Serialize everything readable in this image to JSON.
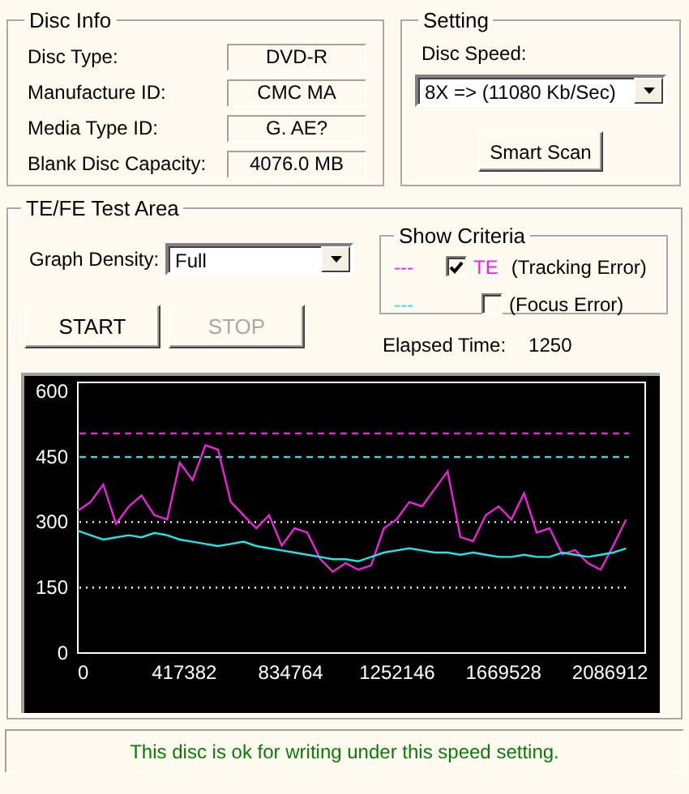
{
  "disc_info": {
    "title": "Disc Info",
    "fields": [
      {
        "label": "Disc Type:",
        "value": "DVD-R"
      },
      {
        "label": "Manufacture ID:",
        "value": "CMC MA"
      },
      {
        "label": "Media Type ID:",
        "value": "G. AE?"
      },
      {
        "label": "Blank Disc Capacity:",
        "value": "4076.0 MB"
      }
    ]
  },
  "setting": {
    "title": "Setting",
    "speed_label": "Disc Speed:",
    "speed_value": "8X => (11080 Kb/Sec)",
    "scan_button": "Smart Scan"
  },
  "test_area": {
    "title": "TE/FE Test Area",
    "density_label": "Graph Density:",
    "density_value": "Full",
    "buttons": [
      {
        "label": "START",
        "disabled": false
      },
      {
        "label": "STOP",
        "disabled": true
      }
    ],
    "criteria": {
      "title": "Show Criteria",
      "items": [
        {
          "marker": "---",
          "color": "#ee22dd",
          "checked": true,
          "name": "TE",
          "description": "(Tracking Error)"
        },
        {
          "marker": "---",
          "color": "#22e5e5",
          "checked": false,
          "description": "(Focus Error)"
        }
      ]
    },
    "elapsed_label": "Elapsed Time:",
    "elapsed_value": "1250",
    "chart_data": {
      "type": "line",
      "xlim": [
        0,
        2225000
      ],
      "ylim": [
        0,
        620
      ],
      "xticks": [
        0,
        417382,
        834764,
        1252146,
        1669528,
        2086912
      ],
      "yticks": [
        0,
        150,
        300,
        450,
        600
      ],
      "x": [
        0,
        50000,
        100000,
        150000,
        200000,
        250000,
        300000,
        350000,
        400000,
        450000,
        500000,
        550000,
        600000,
        650000,
        700000,
        750000,
        800000,
        850000,
        900000,
        950000,
        1000000,
        1050000,
        1100000,
        1150000,
        1200000,
        1250000,
        1300000,
        1350000,
        1400000,
        1450000,
        1500000,
        1550000,
        1600000,
        1650000,
        1700000,
        1750000,
        1800000,
        1850000,
        1900000,
        1950000,
        2000000,
        2050000,
        2100000,
        2150000
      ],
      "series": [
        {
          "color": "#ee22dd",
          "values": [
            326,
            346,
            386,
            296,
            336,
            361,
            316,
            306,
            436,
            396,
            476,
            466,
            346,
            316,
            286,
            316,
            246,
            286,
            276,
            216,
            186,
            206,
            191,
            201,
            286,
            306,
            346,
            336,
            376,
            416,
            266,
            256,
            316,
            336,
            306,
            366,
            276,
            286,
            226,
            236,
            206,
            191,
            246,
            306
          ]
        },
        {
          "color": "#22e5e5",
          "values": [
            280,
            270,
            260,
            265,
            270,
            265,
            275,
            270,
            260,
            255,
            250,
            245,
            250,
            255,
            245,
            240,
            235,
            230,
            225,
            220,
            215,
            215,
            210,
            220,
            230,
            235,
            240,
            235,
            230,
            230,
            225,
            230,
            225,
            220,
            220,
            225,
            220,
            220,
            230,
            225,
            220,
            225,
            230,
            240
          ]
        }
      ],
      "ref_lines": [
        {
          "axis": "y",
          "value": 503,
          "color": "#ee22dd"
        },
        {
          "axis": "y",
          "value": 449,
          "color": "#22e5e5"
        },
        {
          "axis": "y",
          "value": 300,
          "color": "#ffffff"
        },
        {
          "axis": "y",
          "value": 150,
          "color": "#ffffff"
        }
      ]
    }
  },
  "status": "This disc is ok for writing under this speed setting."
}
